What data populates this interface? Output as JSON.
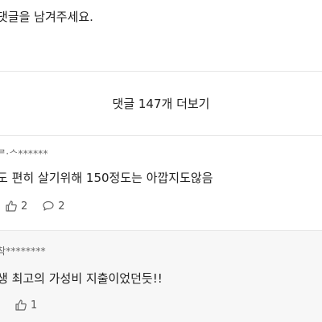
{
  "prompt_text": "댓글을 남겨주세요.",
  "more_comments_label": "댓글 147개 더보기",
  "comments": [
    {
      "author": "ᄅ·ᄉ******",
      "text": "도 편히 살기위해 150정도는 아깝지도않음",
      "like_count": "2",
      "reply_count": "2"
    },
    {
      "author": "착********",
      "text": "생 최고의 가성비 지출이었던듯!!",
      "like_count": "1"
    }
  ],
  "icons": {
    "like": "thumbs-up-icon",
    "reply": "speech-bubble-icon"
  },
  "colors": {
    "divider": "#e6e6e6",
    "highlight_row": "#f7f7f7",
    "meta_text": "#666666",
    "body_text": "#222222"
  }
}
